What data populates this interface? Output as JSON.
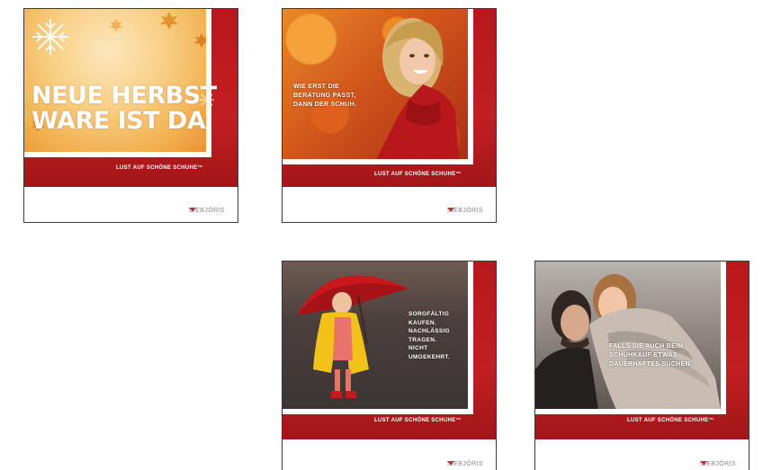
{
  "ads": [
    {
      "headline_lines": [
        "NEUE HERBST",
        "WARE IST DA"
      ],
      "slogan": "LUST AUF SCHÖNE SCHUHE™",
      "brand": "SIEBJÖRIS"
    },
    {
      "headline_lines": [
        "WIE ERST DIE",
        "BERATUNG PASST,",
        "DANN DER SCHUH."
      ],
      "slogan": "LUST AUF SCHÖNE SCHUHE™",
      "brand": "SIEBJÖRIS"
    },
    {
      "headline_lines": [
        "SORGFÄLTIG",
        "KAUFEN.",
        "NACHLÄSSIG",
        "TRAGEN.",
        "NICHT",
        "UMGEKEHRT."
      ],
      "slogan": "LUST AUF SCHÖNE SCHUHE™",
      "brand": "SIEBJÖRIS"
    },
    {
      "headline_lines": [
        "FALLS SIE AUCH BEIM",
        "SCHUHKAUF ETWAS",
        "DAUERHAFTES SUCHEN."
      ],
      "slogan": "LUST AUF SCHÖNE SCHUHE™",
      "brand": "SIEBJÖRIS"
    }
  ]
}
